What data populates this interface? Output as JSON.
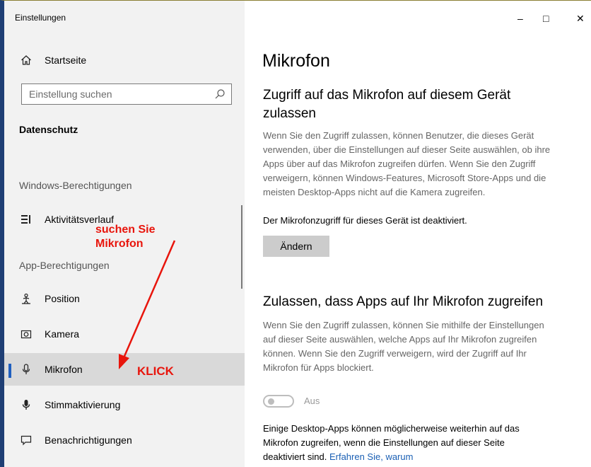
{
  "window": {
    "title": "Einstellungen",
    "controls": {
      "minimize": "–",
      "maximize": "□",
      "close": "✕"
    }
  },
  "sidebar": {
    "home_label": "Startseite",
    "search_placeholder": "Einstellung suchen",
    "category": "Datenschutz",
    "section_windows": "Windows-Berechtigungen",
    "activity_label": "Aktivitätsverlauf",
    "section_apps": "App-Berechtigungen",
    "items": [
      {
        "label": "Position",
        "icon": "person-pin-icon"
      },
      {
        "label": "Kamera",
        "icon": "camera-icon"
      },
      {
        "label": "Mikrofon",
        "icon": "microphone-icon",
        "selected": true
      },
      {
        "label": "Stimmaktivierung",
        "icon": "microphone-filled-icon"
      },
      {
        "label": "Benachrichtigungen",
        "icon": "notification-icon"
      }
    ]
  },
  "main": {
    "title": "Mikrofon",
    "section1_heading_line1": "Zugriff auf das Mikrofon auf diesem Gerät",
    "section1_heading_line2": "zulassen",
    "section1_text": [
      "Wenn Sie den Zugriff zulassen, können Benutzer, die dieses Gerät",
      "verwenden, über die Einstellungen auf dieser Seite auswählen, ob ihre",
      "Apps über auf das Mikrofon zugreifen dürfen. Wenn Sie den Zugriff",
      "verweigern, können Windows-Features, Microsoft Store-Apps und die",
      "meisten Desktop-Apps nicht auf die Kamera zugreifen."
    ],
    "device_status": "Der Mikrofonzugriff für dieses Gerät ist deaktiviert.",
    "change_button": "Ändern",
    "section2_heading": "Zulassen, dass Apps auf Ihr Mikrofon zugreifen",
    "section2_text": [
      "Wenn Sie den Zugriff zulassen, können Sie mithilfe der Einstellungen",
      "auf dieser Seite auswählen, welche Apps auf Ihr Mikrofon zugreifen",
      "können. Wenn Sie den Zugriff verweigern, wird der Zugriff auf Ihr",
      "Mikrofon für Apps blockiert."
    ],
    "toggle_label": "Aus",
    "toggle_on": false,
    "footer_text": [
      "Einige Desktop-Apps können möglicherweise weiterhin auf das",
      "Mikrofon zugreifen, wenn die Einstellungen auf dieser Seite",
      "deaktiviert sind."
    ],
    "footer_link": "Erfahren Sie, warum"
  },
  "annotations": {
    "search_hint_line1": "suchen Sie",
    "search_hint_line2": "Mikrofon",
    "click_label": "KLICK",
    "color": "#e8150c"
  }
}
